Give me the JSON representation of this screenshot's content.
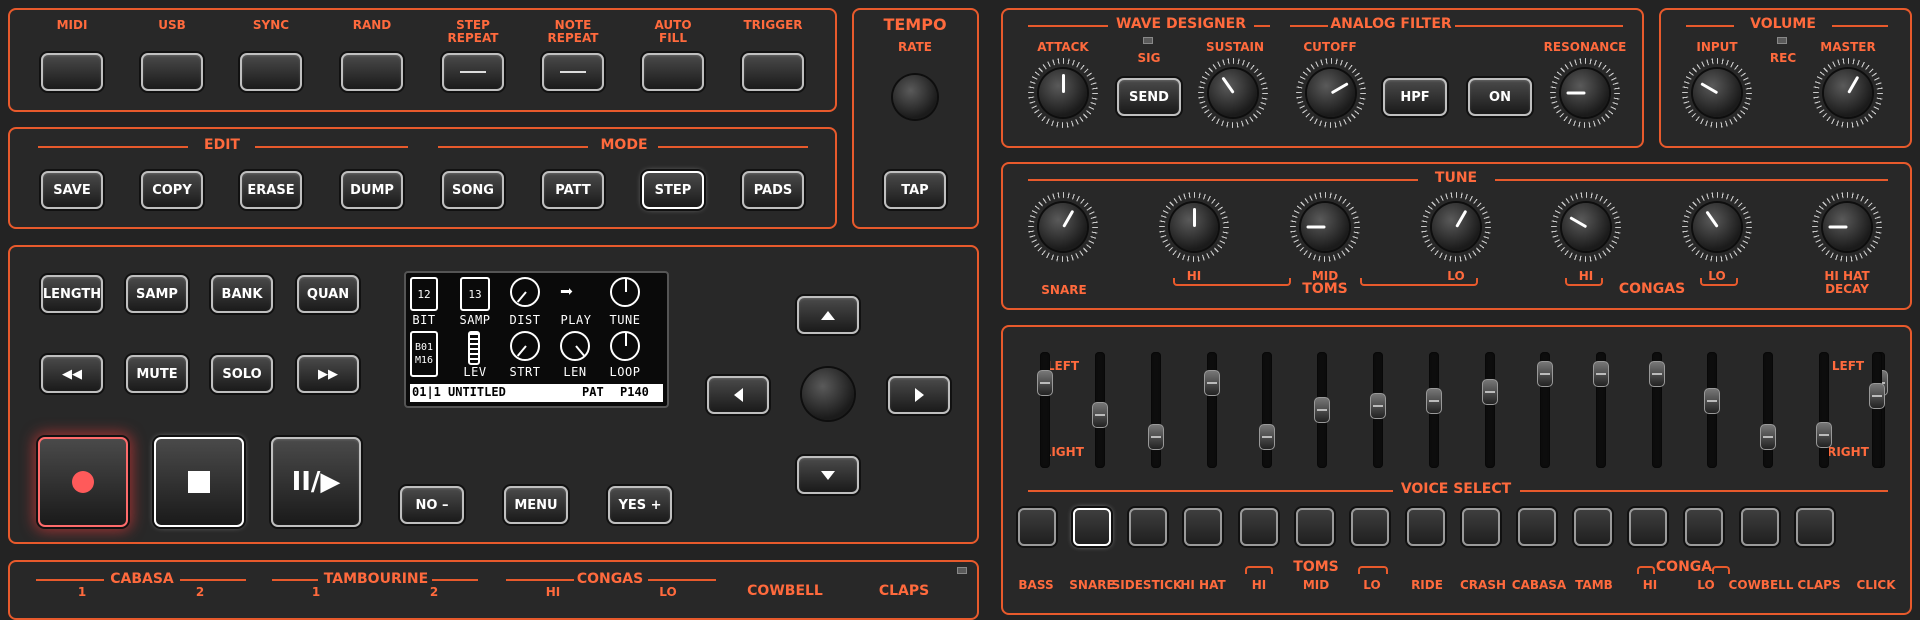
{
  "top_row": {
    "buttons": [
      {
        "label": "MIDI"
      },
      {
        "label": "USB"
      },
      {
        "label": "SYNC"
      },
      {
        "label": "RAND"
      },
      {
        "label": "STEP\nREPEAT",
        "lit": true
      },
      {
        "label": "NOTE\nREPEAT",
        "lit": true
      },
      {
        "label": "AUTO\nFILL"
      },
      {
        "label": "TRIGGER"
      }
    ]
  },
  "edit": {
    "section_label": "EDIT",
    "save": "SAVE",
    "copy": "COPY",
    "erase": "ERASE",
    "dump": "DUMP"
  },
  "mode": {
    "section_label": "MODE",
    "song": "SONG",
    "patt": "PATT",
    "step": "STEP",
    "pads": "PADS"
  },
  "tempo": {
    "title": "TEMPO",
    "rate": "RATE",
    "tap": "TAP"
  },
  "sequencer": {
    "length": "LENGTH",
    "samp": "SAMP",
    "bank": "BANK",
    "quan": "QUAN",
    "mute": "MUTE",
    "solo": "SOLO",
    "no": "NO –",
    "menu": "MENU",
    "yes": "YES +",
    "pause_play": "II/▶"
  },
  "screen": {
    "bit_value": "12",
    "bit": "BIT",
    "samp_value": "13",
    "samp": "SAMP",
    "dist": "DIST",
    "play": "PLAY",
    "tune": "TUNE",
    "bank_value": "B01\nM16",
    "lev": "LEV",
    "strt": "STRT",
    "len": "LEN",
    "loop": "LOOP",
    "status_left": "01|1",
    "status_name": "UNTITLED",
    "status_mode": "PAT",
    "status_tempo": "P140"
  },
  "wave_designer": {
    "title": "WAVE DESIGNER",
    "attack": "ATTACK",
    "sig": "SIG",
    "send": "SEND",
    "sustain": "SUSTAIN"
  },
  "analog_filter": {
    "title": "ANALOG FILTER",
    "cutoff": "CUTOFF",
    "hpf": "HPF",
    "on": "ON",
    "resonance": "RESONANCE"
  },
  "volume": {
    "title": "VOLUME",
    "input": "INPUT",
    "rec": "REC",
    "master": "MASTER"
  },
  "tune": {
    "title": "TUNE",
    "snare": "SNARE",
    "toms_hi": "HI",
    "toms": "TOMS",
    "toms_mid": "MID",
    "toms_lo": "LO",
    "congas_hi": "HI",
    "congas": "CONGAS",
    "congas_lo": "LO",
    "hihat_decay": "HI HAT\nDECAY"
  },
  "mixer": {
    "left": "LEFT",
    "right": "RIGHT",
    "left2": "LEFT",
    "right2": "RIGHT",
    "fader_levels": [
      0.2,
      0.55,
      0.8,
      0.2,
      0.8,
      0.5,
      0.45,
      0.4,
      0.3,
      0.1,
      0.1,
      0.1,
      0.4,
      0.8,
      0.78,
      0.2,
      0.35
    ]
  },
  "voice_select": {
    "title": "VOICE SELECT",
    "selected": 1,
    "labels": [
      "BASS",
      "SNARE",
      "SIDESTICK",
      "HI HAT",
      "HI",
      "MID",
      "LO",
      "RIDE",
      "CRASH",
      "CABASA",
      "TAMB",
      "HI",
      "LO",
      "COWBELL",
      "CLAPS",
      "CLICK"
    ],
    "toms": "TOMS",
    "conga": "CONGA"
  },
  "bottom": {
    "cabasa": "CABASA",
    "cab_1": "1",
    "cab_2": "2",
    "tambourine": "TAMBOURINE",
    "tam_1": "1",
    "tam_2": "2",
    "congas": "CONGAS",
    "con_hi": "HI",
    "con_lo": "LO",
    "cowbell": "COWBELL",
    "claps": "CLAPS"
  },
  "colors": {
    "accent": "#e85a2c",
    "panel": "#282828",
    "rec_glow": "#ff4040"
  }
}
